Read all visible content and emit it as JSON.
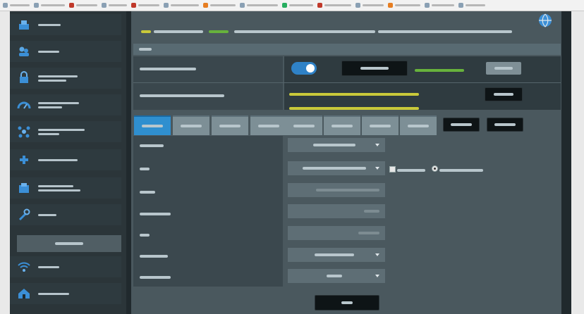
{
  "browser": {
    "bookmarks": [
      {
        "icon": "bookmark-icon"
      },
      {
        "icon": "bookmark-icon"
      },
      {
        "icon": "bookmark-icon"
      },
      {
        "icon": "bookmark-icon"
      },
      {
        "icon": "bookmark-icon"
      },
      {
        "icon": "bookmark-icon"
      },
      {
        "icon": "bookmark-icon"
      },
      {
        "icon": "bookmark-icon"
      },
      {
        "icon": "bookmark-icon"
      },
      {
        "icon": "bookmark-icon"
      },
      {
        "icon": "bookmark-icon"
      },
      {
        "icon": "bookmark-icon"
      },
      {
        "icon": "bookmark-icon"
      },
      {
        "icon": "bookmark-icon"
      }
    ]
  },
  "sidebar": {
    "items": [
      {
        "icon": "network-map-icon",
        "label": ""
      },
      {
        "icon": "guest-network-icon",
        "label": ""
      },
      {
        "icon": "aiprotection-lock-icon",
        "label": ""
      },
      {
        "icon": "adaptive-qos-gauge-icon",
        "label": ""
      },
      {
        "icon": "traffic-analyzer-icon",
        "label": ""
      },
      {
        "icon": "usb-application-icon",
        "label": ""
      },
      {
        "icon": "aicloud-icon",
        "label": ""
      },
      {
        "icon": "tools-wrench-icon",
        "label": ""
      }
    ],
    "section_label": "",
    "sub_items": [
      {
        "icon": "wireless-wifi-icon",
        "label": ""
      },
      {
        "icon": "lan-home-icon",
        "label": ""
      }
    ]
  },
  "header": {
    "assistant_icon": "globe-icon"
  },
  "notice": {
    "prefix": "",
    "link": "",
    "text": ""
  },
  "panel": {
    "title": ""
  },
  "rows": {
    "top1_label": "",
    "top1_button": "",
    "top1_status": "",
    "top1_grey_button": "",
    "top2_label": "",
    "top2_line1": "",
    "top2_line2": "",
    "top2_button": "",
    "toggle_on": true
  },
  "tabs": [
    {
      "label": ""
    },
    {
      "label": ""
    },
    {
      "label": ""
    },
    {
      "label": ""
    },
    {
      "label": ""
    },
    {
      "label": ""
    },
    {
      "label": ""
    },
    {
      "label": ""
    }
  ],
  "tab_buttons": {
    "left": "",
    "right": ""
  },
  "form": [
    {
      "label": "",
      "value": "",
      "type": "select"
    },
    {
      "label": "",
      "value": "",
      "type": "select"
    },
    {
      "label": "",
      "value": "",
      "type": "text"
    },
    {
      "label": "",
      "value": "",
      "type": "text"
    },
    {
      "label": "",
      "value": "",
      "type": "text"
    },
    {
      "label": "",
      "value": "",
      "type": "select"
    },
    {
      "label": "",
      "value": "",
      "type": "select"
    }
  ],
  "options": {
    "checkbox_label": "",
    "radio_label": ""
  },
  "apply_button": "",
  "colors": {
    "accent_blue": "#2f8fcf",
    "sidebar_bg": "#2b3539",
    "panel_bg": "#4a585e",
    "warning_yellow": "#c9c93a",
    "status_green": "#67b23c"
  }
}
